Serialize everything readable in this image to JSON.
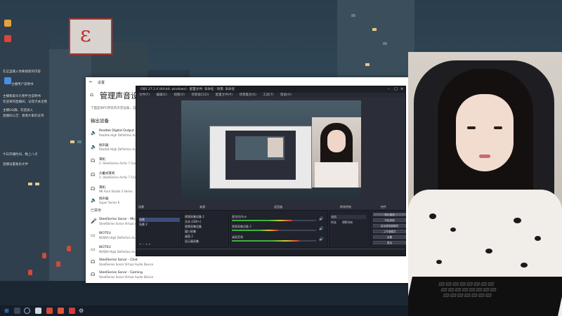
{
  "settings": {
    "window_title": "设置",
    "page_title": "管理声音设备",
    "subtitle": "下面是你PC所有的声音设备，选择...",
    "output_section": "输出设备",
    "input_section": "已禁用",
    "output_devices": [
      {
        "name": "Realtek Digital Output",
        "sub": "Realtek High Definition Au..."
      },
      {
        "name": "扬声器",
        "sub": "Realtek High Definition Au..."
      },
      {
        "name": "耳机",
        "sub": "2- SteelSeries Arctis 7 Gam..."
      },
      {
        "name": "头戴式耳机",
        "sub": "2- SteelSeries Arctis 7 Chat"
      },
      {
        "name": "耳机",
        "sub": "HK Aura Studio 3 Series"
      },
      {
        "name": "扬声器",
        "sub": "Super Series K"
      }
    ],
    "disabled_devices": [
      {
        "name": "SteelSeries Sonar - Microph...",
        "sub": "SteelSeries Sonar Virtual Au..."
      },
      {
        "name": "BIOTEU",
        "sub": "NVIDIA High Definition Au..."
      },
      {
        "name": "BIOTEU",
        "sub": "NVIDIA High Definition Au..."
      },
      {
        "name": "SteelSeries Sonar - Chat",
        "sub": "SteelSeries Sonar Virtual Audio Device"
      },
      {
        "name": "SteelSeries Sonar - Gaming",
        "sub": "SteelSeries Sonar Virtual Audio Device"
      }
    ]
  },
  "obs": {
    "title": "OBS 27.2.4 (64-bit, windows) · 配置文件: 未命名 · 场景: 未命名",
    "menu": [
      "文件(F)",
      "编辑(E)",
      "视图(V)",
      "停靠窗口(D)",
      "配置文件(P)",
      "场景集合(S)",
      "工具(T)",
      "帮助(H)"
    ],
    "scenes_title": "场景",
    "sources_title": "来源",
    "mixer_title": "混音器",
    "transition_title": "转场特效",
    "controls_title": "控件",
    "scenes": [
      "场景",
      "场景 2"
    ],
    "sources": [
      "视频采集设备 2",
      "文本 (GDI+)",
      "视频采集设备",
      "窗口采集",
      "桌面 2",
      "显示器采集"
    ],
    "mixer_channels": [
      {
        "label": "麦克风/Aux",
        "level": 0.72
      },
      {
        "label": "视频采集设备 2",
        "level": 0.55
      },
      {
        "label": "桌面音频",
        "level": 0.8
      }
    ],
    "transition": {
      "type": "淡出",
      "duration_label": "时长",
      "duration": "300 ms"
    },
    "controls": [
      "停止推流",
      "开始录制",
      "启动虚拟摄像机",
      "工作室模式",
      "设置",
      "退出"
    ]
  },
  "desktop": {
    "texts": [
      "在这里输入你要搜索的内容",
      "主播用户说明书",
      "主播和观众礼物平台说明书",
      "欢迎来到直播间，记得点关注哦",
      "主播QQ群，欢迎加入",
      "直播间公告：感谢大家的支持",
      "今日开播时间，晚上八点",
      "直播设置备份文件"
    ]
  },
  "taskbar": {
    "icons": [
      "windows-start-icon",
      "search-icon",
      "task-view-icon",
      "obs-icon",
      "browser-icon",
      "music-icon",
      "settings-icon"
    ]
  }
}
